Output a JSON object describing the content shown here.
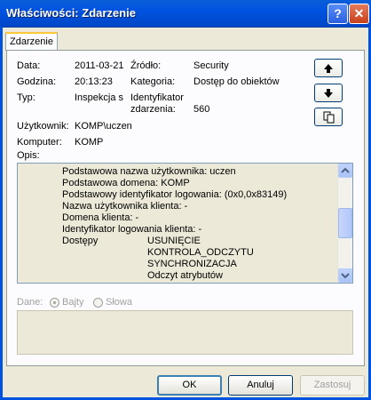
{
  "window": {
    "title": "Właściwości: Zdarzenie",
    "help_label": "?",
    "close_label": "✕"
  },
  "tab": {
    "label": "Zdarzenie"
  },
  "fields": {
    "data_label": "Data:",
    "data_value": "2011-03-21",
    "godzina_label": "Godzina:",
    "godzina_value": "20:13:23",
    "typ_label": "Typ:",
    "typ_value": "Inspekcja s",
    "zrodlo_label": "Źródło:",
    "zrodlo_value": "Security",
    "kategoria_label": "Kategoria:",
    "kategoria_value": "Dostęp do obiektów",
    "identyfikator_label_1": "Identyfikator",
    "identyfikator_label_2": "zdarzenia:",
    "identyfikator_value": "560",
    "uzytkownik_label": "Użytkownik:",
    "uzytkownik_value": "KOMP\\uczen",
    "komputer_label": "Komputer:",
    "komputer_value": "KOMP",
    "opis_label": "Opis:"
  },
  "nav": {
    "up_icon": "arrow-up-icon",
    "down_icon": "arrow-down-icon",
    "copy_icon": "copy-icon"
  },
  "description": {
    "lines": [
      "Podstawowa nazwa użytkownika: uczen",
      "Podstawowa domena: KOMP",
      "Podstawowy identyfikator logowania: (0x0,0x83149)",
      "Nazwa użytkownika klienta: -",
      "Domena klienta: -",
      "Identyfikator logowania klienta: -"
    ],
    "dostepy_label": "Dostępy",
    "dostepy_values": [
      "USUNIĘCIE",
      "KONTROLA_ODCZYTU",
      "SYNCHRONIZACJA",
      "Odczyt atrybutów"
    ]
  },
  "data_section": {
    "label": "Dane:",
    "bajty_label": "Bajty",
    "slowa_label": "Słowa",
    "selected": "Bajty"
  },
  "buttons": {
    "ok": "OK",
    "anuluj": "Anuluj",
    "zastosuj": "Zastosuj"
  }
}
